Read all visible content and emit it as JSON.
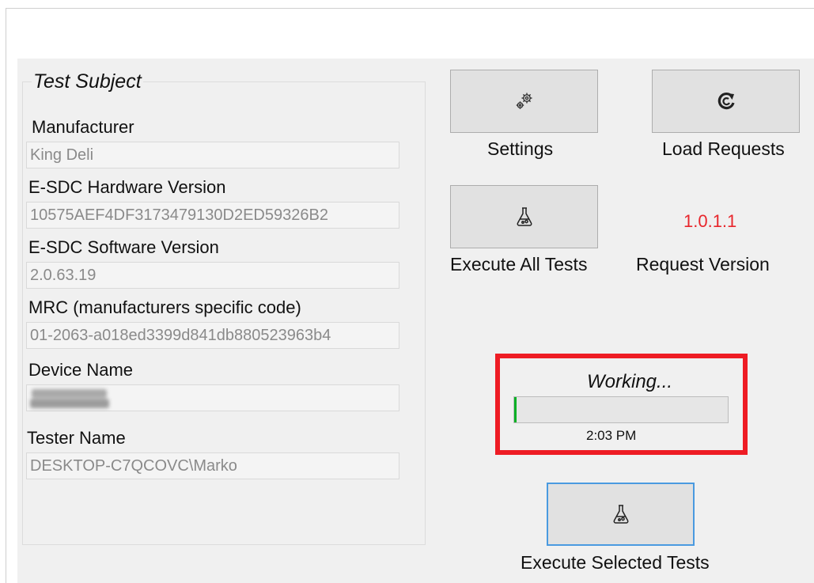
{
  "test_subject": {
    "title": "Test Subject",
    "manufacturer": {
      "label": "Manufacturer",
      "value": "King Deli"
    },
    "hardware_version": {
      "label": "E-SDC Hardware Version",
      "value": "10575AEF4DF3173479130D2ED59326B2"
    },
    "software_version": {
      "label": "E-SDC Software Version",
      "value": "2.0.63.19"
    },
    "mrc": {
      "label": "MRC (manufacturers specific code)",
      "value": "01-2063-a018ed3399d841db880523963b4"
    },
    "device_name": {
      "label": "Device Name",
      "value": ""
    },
    "tester_name": {
      "label": "Tester Name",
      "value": "DESKTOP-C7QCOVC\\Marko"
    }
  },
  "actions": {
    "settings": {
      "label": "Settings",
      "icon": "gears-icon"
    },
    "load_requests": {
      "label": "Load Requests",
      "icon": "refresh-icon"
    },
    "execute_all": {
      "label": "Execute All Tests",
      "icon": "flask-icon"
    },
    "execute_selected": {
      "label": "Execute Selected Tests",
      "icon": "flask-icon"
    }
  },
  "request_version": {
    "value": "1.0.1.1",
    "label": "Request Version",
    "color": "#e8262c"
  },
  "status": {
    "text": "Working...",
    "progress_percent": 1,
    "time": "2:03 PM",
    "highlight_color": "#ee1c24",
    "progress_color": "#06b025"
  }
}
